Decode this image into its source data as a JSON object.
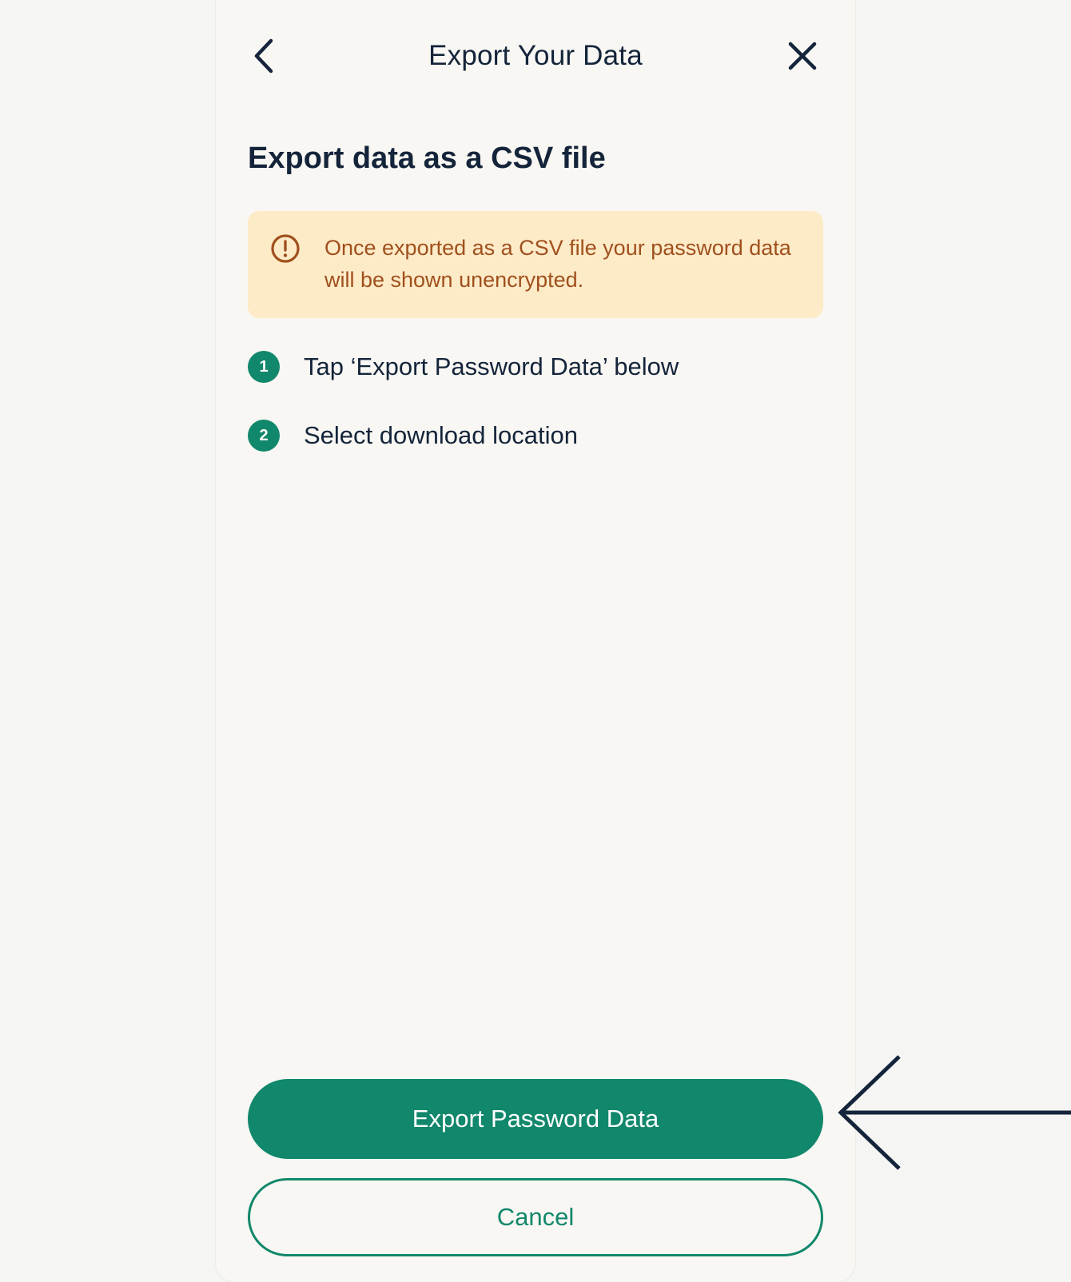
{
  "header": {
    "title": "Export Your Data",
    "back_icon": "chevron-left-icon",
    "close_icon": "close-icon"
  },
  "content": {
    "section_title": "Export data as a CSV file",
    "warning": {
      "icon": "exclamation-circle-icon",
      "text": "Once exported as a CSV file your password data will be shown unencrypted."
    },
    "steps": [
      {
        "number": "1",
        "text": "Tap ‘Export Password Data’ below"
      },
      {
        "number": "2",
        "text": "Select download location"
      }
    ]
  },
  "actions": {
    "primary_label": "Export Password Data",
    "secondary_label": "Cancel"
  },
  "annotation": {
    "icon": "pointer-arrow-icon"
  },
  "colors": {
    "accent": "#11876b",
    "text_dark": "#14243a",
    "warning_bg": "#fdebc8",
    "warning_text": "#a0501d",
    "panel_bg": "#f8f7f3",
    "page_bg": "#f5f5f4"
  }
}
